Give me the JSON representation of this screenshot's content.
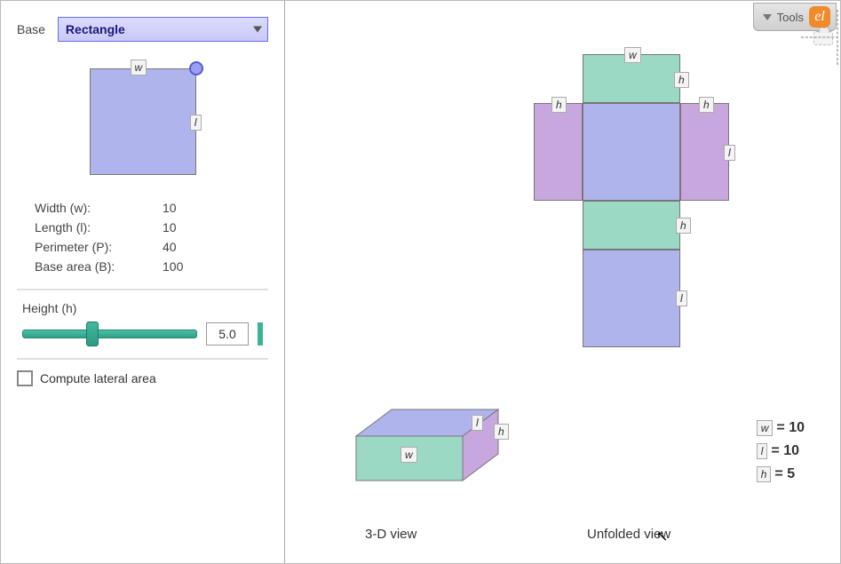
{
  "sidebar": {
    "base_label": "Base",
    "base_options": [
      "Rectangle"
    ],
    "base_selected": "Rectangle",
    "preview": {
      "w_tag": "w",
      "l_tag": "l"
    },
    "stats": {
      "width_label": "Width (w):",
      "width_value": "10",
      "length_label": "Length (l):",
      "length_value": "10",
      "perimeter_label": "Perimeter (P):",
      "perimeter_value": "40",
      "basearea_label": "Base area (B):",
      "basearea_value": "100"
    },
    "height": {
      "title": "Height (h)",
      "value": "5.0"
    },
    "checkbox_label": "Compute lateral area"
  },
  "main": {
    "tools_label": "Tools",
    "net_tags": {
      "w": "w",
      "l": "l",
      "h": "h"
    },
    "legend": {
      "w_tag": "w",
      "w_eq": " = 10",
      "l_tag": "l",
      "l_eq": " = 10",
      "h_tag": "h",
      "h_eq": " = 5"
    },
    "caption_3d": "3-D view",
    "caption_unfolded": "Unfolded view"
  },
  "colors": {
    "blue": "#b0b4ec",
    "green": "#9cd9c5",
    "purple": "#c8a7df",
    "accent_teal": "#39b39a",
    "accent_orange": "#f08a2a"
  }
}
